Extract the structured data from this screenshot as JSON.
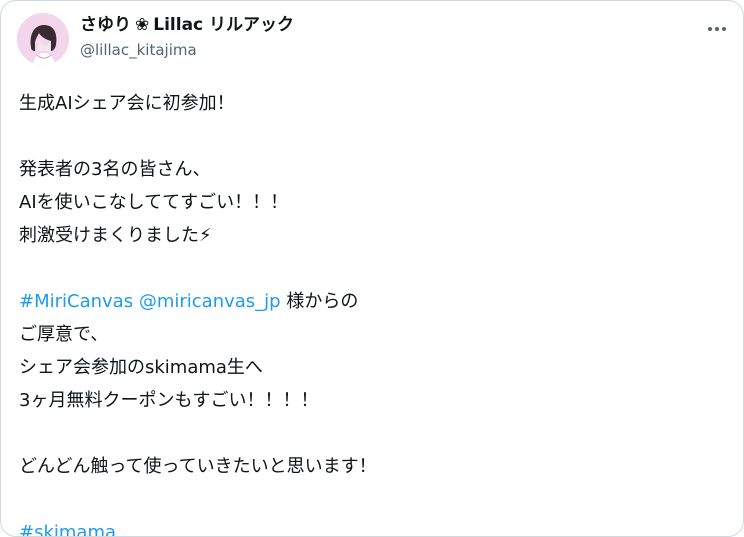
{
  "user": {
    "name_prefix": "さゆり",
    "clover_glyph": "❀",
    "name_suffix": "Lillac リルアック",
    "handle": "@lillac_kitajima"
  },
  "post": {
    "line1": "生成AIシェア会に初参加！",
    "line2": "発表者の3名の皆さん、",
    "line3": "AIを使いこなしててすごい！！！",
    "line4": "刺激受けまくりました⚡",
    "hashtag1": "#MiriCanvas",
    "mention1": "@miricanvas_jp",
    "line5_rest": " 様からの",
    "line6": "ご厚意で、",
    "line7": "シェア会参加のskimama生へ",
    "line8": "3ヶ月無料クーポンもすごい！！！！",
    "line9": "どんどん触って使っていきたいと思います！",
    "hashtag2": "#skimama"
  },
  "colors": {
    "link": "#1d9bf0",
    "text": "#0f1419",
    "secondary": "#536471",
    "avatar_bg": "#f3d5ec"
  },
  "icons": {
    "more": "more-horizontal-icon",
    "clover": "clover-icon"
  }
}
